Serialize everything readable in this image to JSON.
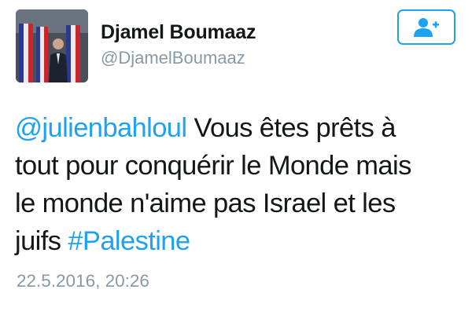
{
  "user": {
    "display_name": "Djamel Boumaaz",
    "handle": "@DjamelBoumaaz",
    "avatar_icon": "profile-photo"
  },
  "follow_button": {
    "icon": "add-user-icon",
    "accent_color": "#1da1f2"
  },
  "tweet": {
    "mention": "@julienbahloul",
    "line1_text": " Vous êtes prêts à",
    "line2": "tout pour conquérir le Monde mais",
    "line3": "le monde n'aime pas Israel et les",
    "line4_text": "juifs ",
    "hashtag": "#Palestine",
    "timestamp": "22.5.2016, 20:26"
  },
  "colors": {
    "text": "#14171a",
    "link": "#1da1f2",
    "muted": "#8899a6"
  }
}
